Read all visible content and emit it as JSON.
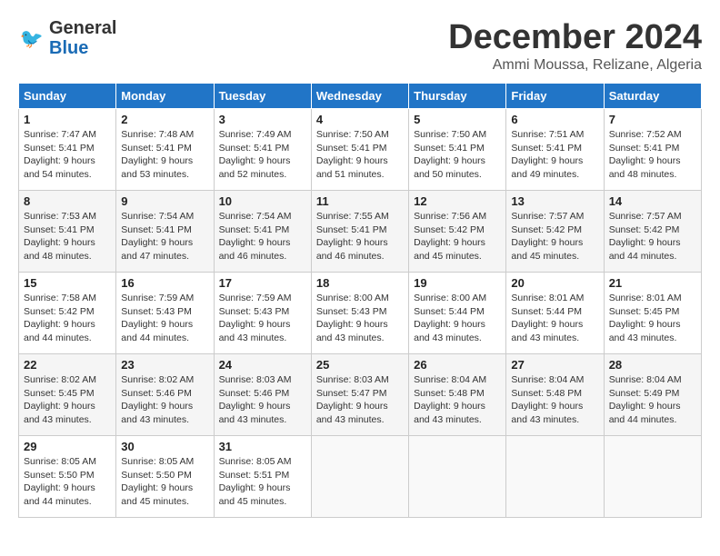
{
  "header": {
    "logo_general": "General",
    "logo_blue": "Blue",
    "month": "December 2024",
    "location": "Ammi Moussa, Relizane, Algeria"
  },
  "weekdays": [
    "Sunday",
    "Monday",
    "Tuesday",
    "Wednesday",
    "Thursday",
    "Friday",
    "Saturday"
  ],
  "weeks": [
    [
      {
        "day": "1",
        "sunrise": "7:47 AM",
        "sunset": "5:41 PM",
        "daylight": "9 hours and 54 minutes."
      },
      {
        "day": "2",
        "sunrise": "7:48 AM",
        "sunset": "5:41 PM",
        "daylight": "9 hours and 53 minutes."
      },
      {
        "day": "3",
        "sunrise": "7:49 AM",
        "sunset": "5:41 PM",
        "daylight": "9 hours and 52 minutes."
      },
      {
        "day": "4",
        "sunrise": "7:50 AM",
        "sunset": "5:41 PM",
        "daylight": "9 hours and 51 minutes."
      },
      {
        "day": "5",
        "sunrise": "7:50 AM",
        "sunset": "5:41 PM",
        "daylight": "9 hours and 50 minutes."
      },
      {
        "day": "6",
        "sunrise": "7:51 AM",
        "sunset": "5:41 PM",
        "daylight": "9 hours and 49 minutes."
      },
      {
        "day": "7",
        "sunrise": "7:52 AM",
        "sunset": "5:41 PM",
        "daylight": "9 hours and 48 minutes."
      }
    ],
    [
      {
        "day": "8",
        "sunrise": "7:53 AM",
        "sunset": "5:41 PM",
        "daylight": "9 hours and 48 minutes."
      },
      {
        "day": "9",
        "sunrise": "7:54 AM",
        "sunset": "5:41 PM",
        "daylight": "9 hours and 47 minutes."
      },
      {
        "day": "10",
        "sunrise": "7:54 AM",
        "sunset": "5:41 PM",
        "daylight": "9 hours and 46 minutes."
      },
      {
        "day": "11",
        "sunrise": "7:55 AM",
        "sunset": "5:41 PM",
        "daylight": "9 hours and 46 minutes."
      },
      {
        "day": "12",
        "sunrise": "7:56 AM",
        "sunset": "5:42 PM",
        "daylight": "9 hours and 45 minutes."
      },
      {
        "day": "13",
        "sunrise": "7:57 AM",
        "sunset": "5:42 PM",
        "daylight": "9 hours and 45 minutes."
      },
      {
        "day": "14",
        "sunrise": "7:57 AM",
        "sunset": "5:42 PM",
        "daylight": "9 hours and 44 minutes."
      }
    ],
    [
      {
        "day": "15",
        "sunrise": "7:58 AM",
        "sunset": "5:42 PM",
        "daylight": "9 hours and 44 minutes."
      },
      {
        "day": "16",
        "sunrise": "7:59 AM",
        "sunset": "5:43 PM",
        "daylight": "9 hours and 44 minutes."
      },
      {
        "day": "17",
        "sunrise": "7:59 AM",
        "sunset": "5:43 PM",
        "daylight": "9 hours and 43 minutes."
      },
      {
        "day": "18",
        "sunrise": "8:00 AM",
        "sunset": "5:43 PM",
        "daylight": "9 hours and 43 minutes."
      },
      {
        "day": "19",
        "sunrise": "8:00 AM",
        "sunset": "5:44 PM",
        "daylight": "9 hours and 43 minutes."
      },
      {
        "day": "20",
        "sunrise": "8:01 AM",
        "sunset": "5:44 PM",
        "daylight": "9 hours and 43 minutes."
      },
      {
        "day": "21",
        "sunrise": "8:01 AM",
        "sunset": "5:45 PM",
        "daylight": "9 hours and 43 minutes."
      }
    ],
    [
      {
        "day": "22",
        "sunrise": "8:02 AM",
        "sunset": "5:45 PM",
        "daylight": "9 hours and 43 minutes."
      },
      {
        "day": "23",
        "sunrise": "8:02 AM",
        "sunset": "5:46 PM",
        "daylight": "9 hours and 43 minutes."
      },
      {
        "day": "24",
        "sunrise": "8:03 AM",
        "sunset": "5:46 PM",
        "daylight": "9 hours and 43 minutes."
      },
      {
        "day": "25",
        "sunrise": "8:03 AM",
        "sunset": "5:47 PM",
        "daylight": "9 hours and 43 minutes."
      },
      {
        "day": "26",
        "sunrise": "8:04 AM",
        "sunset": "5:48 PM",
        "daylight": "9 hours and 43 minutes."
      },
      {
        "day": "27",
        "sunrise": "8:04 AM",
        "sunset": "5:48 PM",
        "daylight": "9 hours and 43 minutes."
      },
      {
        "day": "28",
        "sunrise": "8:04 AM",
        "sunset": "5:49 PM",
        "daylight": "9 hours and 44 minutes."
      }
    ],
    [
      {
        "day": "29",
        "sunrise": "8:05 AM",
        "sunset": "5:50 PM",
        "daylight": "9 hours and 44 minutes."
      },
      {
        "day": "30",
        "sunrise": "8:05 AM",
        "sunset": "5:50 PM",
        "daylight": "9 hours and 45 minutes."
      },
      {
        "day": "31",
        "sunrise": "8:05 AM",
        "sunset": "5:51 PM",
        "daylight": "9 hours and 45 minutes."
      },
      null,
      null,
      null,
      null
    ]
  ]
}
